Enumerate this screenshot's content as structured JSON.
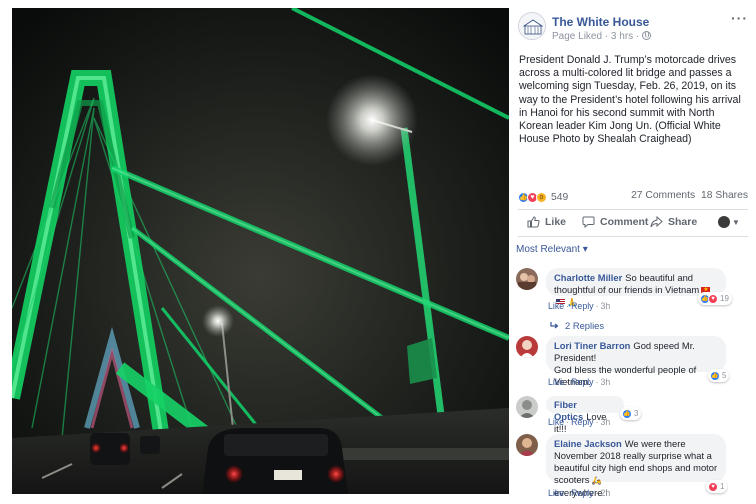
{
  "post": {
    "page_name": "The White House",
    "meta": "Page Liked · 3 hrs ·",
    "more": "···",
    "caption": "President Donald J. Trump’s motorcade drives across a multi-colored lit bridge and passes a welcoming sign Tuesday, Feb. 26, 2019, on its way to the President’s hotel following his arrival in Hanoi for his second summit with North Korean leader Kim Jong Un. (Official White House Photo by Shealah Craighead)",
    "icons": {
      "privacy": "globe-icon",
      "avatar": "white-house-logo"
    }
  },
  "stats": {
    "reaction_count": "549",
    "reaction_types": [
      "like",
      "love",
      "wow"
    ],
    "comments": "27 Comments",
    "shares": "18 Shares"
  },
  "actions": {
    "like": "Like",
    "comment": "Comment",
    "share": "Share"
  },
  "filter": {
    "label": "Most Relevant ▾"
  },
  "comments": [
    {
      "author": "Charlotte Miller",
      "text": "So beautiful and thoughtful of our friends in Vietnam",
      "emoji": [
        "flag-vietnam",
        "flag-usa",
        "praying-hands"
      ],
      "like": "Like",
      "reply": "Reply",
      "time": "3h",
      "reaction_count": "19",
      "reaction_types": [
        "like",
        "love"
      ],
      "replies_label": "2 Replies"
    },
    {
      "author": "Lori Tiner Barron",
      "line1": "God speed Mr. President!",
      "line2": "God bless the wonderful people of Vietnam.",
      "like": "Like",
      "reply": "Reply",
      "time": "3h",
      "reaction_count": "5",
      "reaction_types": [
        "like"
      ]
    },
    {
      "author": "Fiber Optics",
      "text": "Love it!!!",
      "like": "Like",
      "reply": "Reply",
      "time": "3h",
      "reaction_count": "3",
      "reaction_types": [
        "like"
      ]
    },
    {
      "author": "Elaine Jackson",
      "text": "We were there November 2018 really surprise what a beautiful city high end shops and motor scooters",
      "text_end": "everywhere !",
      "emoji": [
        "motor-scooter"
      ],
      "like": "Like",
      "reply": "Reply",
      "time": "2h",
      "reaction_count": "1",
      "reaction_types": [
        "love"
      ]
    }
  ],
  "colors": {
    "link_blue": "#385898",
    "like_blue": "#2f7cf6",
    "love_red": "#f33e58",
    "wow_yellow": "#f7b125",
    "bubble_gray": "#f2f3f5",
    "bridge_green": "#19d96a"
  }
}
